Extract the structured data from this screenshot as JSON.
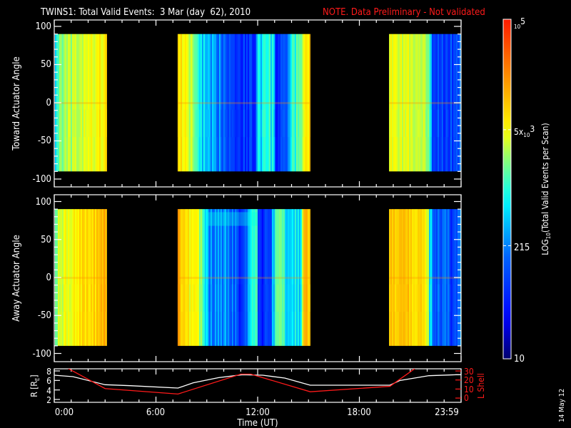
{
  "chart_data": {
    "type": "heatmap",
    "title": "TWINS1: Total Valid Events:  3 Mar (day  62), 2010",
    "note": "NOTE. Data Preliminary - Not validated",
    "x": {
      "label": "Time (UT)",
      "range_hours": [
        0,
        24
      ],
      "tick_hours": [
        0,
        6,
        12,
        18,
        24
      ],
      "tick_labels": [
        "0:00",
        "6:00",
        "12:00",
        "18:00",
        "23:59"
      ]
    },
    "colorbar": {
      "label_prefix": "LOG",
      "label_sub": "10",
      "label_suffix": "(Total Valid Events per Scan)",
      "scale": "log10",
      "range": [
        10,
        100000
      ],
      "ticks": [
        {
          "value": 100000,
          "base": "10",
          "exp": "5"
        },
        {
          "value": 5000,
          "pre": "5x",
          "base": "10",
          "exp": "3"
        },
        {
          "value": 215,
          "text": "215"
        },
        {
          "value": 10,
          "text": "10"
        }
      ]
    },
    "panels": [
      {
        "ylabel": "Toward Actuator Angle",
        "ylim": [
          -110,
          108
        ],
        "yticks": [
          100,
          50,
          0,
          -50,
          -100
        ],
        "ytick_labels": [
          "100",
          "50",
          "0",
          "-50",
          "-100"
        ],
        "angle_range": [
          -90,
          90
        ],
        "blocks": [
          {
            "start": 0.04,
            "end": 3.1,
            "profile": [
              [
                0.04,
                2.9
              ],
              [
                0.3,
                3.35
              ],
              [
                1.5,
                3.5
              ],
              [
                2.5,
                3.7
              ],
              [
                2.9,
                3.75
              ],
              [
                3.1,
                4.0
              ]
            ]
          },
          {
            "start": 7.28,
            "end": 15.1,
            "profile": [
              [
                7.28,
                3.85
              ],
              [
                7.7,
                3.7
              ],
              [
                8.1,
                3.4
              ],
              [
                8.5,
                3.0
              ],
              [
                9.0,
                2.4
              ],
              [
                10.0,
                2.3
              ],
              [
                10.7,
                1.9
              ],
              [
                11.8,
                1.8
              ],
              [
                12.0,
                2.8
              ],
              [
                12.8,
                2.9
              ],
              [
                13.1,
                1.8
              ],
              [
                13.6,
                1.8
              ],
              [
                13.9,
                2.9
              ],
              [
                14.4,
                3.0
              ],
              [
                14.7,
                3.8
              ],
              [
                15.1,
                3.9
              ]
            ]
          },
          {
            "start": 19.75,
            "end": 24,
            "profile": [
              [
                19.75,
                3.7
              ],
              [
                21.0,
                3.55
              ],
              [
                22.0,
                3.4
              ],
              [
                22.1,
                2.8
              ],
              [
                22.3,
                2.0
              ],
              [
                23.2,
                1.9
              ],
              [
                23.8,
                2.0
              ],
              [
                24,
                2.8
              ]
            ]
          }
        ]
      },
      {
        "ylabel": "Away Actuator Angle",
        "ylim": [
          -110,
          108
        ],
        "yticks": [
          100,
          50,
          0,
          -50,
          -100
        ],
        "ytick_labels": [
          "100",
          "50",
          "0",
          "-50",
          "-100"
        ],
        "angle_range": [
          -90,
          90
        ],
        "blocks": [
          {
            "start": 0.04,
            "end": 3.1,
            "profile": [
              [
                0.04,
                3.3
              ],
              [
                0.3,
                3.6
              ],
              [
                1.2,
                3.8
              ],
              [
                2.5,
                3.95
              ],
              [
                3.1,
                4.15
              ]
            ]
          },
          {
            "start": 7.28,
            "end": 15.1,
            "profile": [
              [
                7.28,
                4.15
              ],
              [
                7.7,
                3.8
              ],
              [
                8.2,
                3.75
              ],
              [
                8.6,
                3.4
              ],
              [
                9.0,
                2.5
              ],
              [
                10.3,
                2.3
              ],
              [
                10.6,
                2.0
              ],
              [
                11.3,
                1.9
              ],
              [
                11.5,
                3.0
              ],
              [
                11.9,
                3.0
              ],
              [
                12.0,
                1.8
              ],
              [
                12.7,
                1.8
              ],
              [
                13.0,
                3.2
              ],
              [
                13.5,
                3.2
              ],
              [
                13.7,
                2.7
              ],
              [
                14.5,
                2.8
              ],
              [
                14.7,
                4.0
              ],
              [
                15.1,
                4.1
              ]
            ]
          },
          {
            "start": 19.75,
            "end": 24,
            "profile": [
              [
                19.75,
                4.05
              ],
              [
                21.5,
                3.9
              ],
              [
                22.0,
                3.7
              ],
              [
                22.1,
                2.9
              ],
              [
                22.4,
                2.0
              ],
              [
                23.8,
                2.0
              ],
              [
                24,
                2.7
              ]
            ]
          }
        ]
      }
    ],
    "ephemeris": {
      "r": {
        "label_prefix": "R [R",
        "label_sub": "E",
        "label_suffix": "]",
        "ylim": [
          1.4,
          8.45
        ],
        "ticks": [
          2,
          4,
          6,
          8
        ],
        "tick_labels": [
          "2",
          "4",
          "6",
          "8"
        ],
        "color": "#ffffff",
        "points": [
          [
            0,
            7.1
          ],
          [
            1.1,
            6.8
          ],
          [
            3.0,
            5.1
          ],
          [
            4.5,
            4.9
          ],
          [
            7.3,
            4.4
          ],
          [
            8.2,
            5.5
          ],
          [
            9.7,
            6.6
          ],
          [
            11.1,
            7.2
          ],
          [
            12.3,
            7.1
          ],
          [
            13.6,
            6.5
          ],
          [
            15.1,
            5.0
          ],
          [
            19.8,
            5.0
          ],
          [
            20.4,
            6.0
          ],
          [
            22.1,
            7.0
          ],
          [
            23.7,
            7.2
          ],
          [
            24,
            7.2
          ]
        ]
      },
      "l_shell": {
        "label": "L Shell",
        "ylim": [
          -4.7,
          32.4
        ],
        "ticks": [
          0,
          10,
          20,
          30
        ],
        "tick_labels": [
          "0",
          "10",
          "20",
          "30"
        ],
        "color": "#ff1a1a",
        "points": [
          [
            0.6,
            35
          ],
          [
            3.0,
            10.5
          ],
          [
            7.3,
            4.5
          ],
          [
            11.0,
            26.5
          ],
          [
            11.6,
            26.5
          ],
          [
            15.1,
            7.0
          ],
          [
            19.8,
            13.0
          ],
          [
            21.3,
            33
          ]
        ]
      }
    },
    "date_stamp": "14 May 12"
  }
}
